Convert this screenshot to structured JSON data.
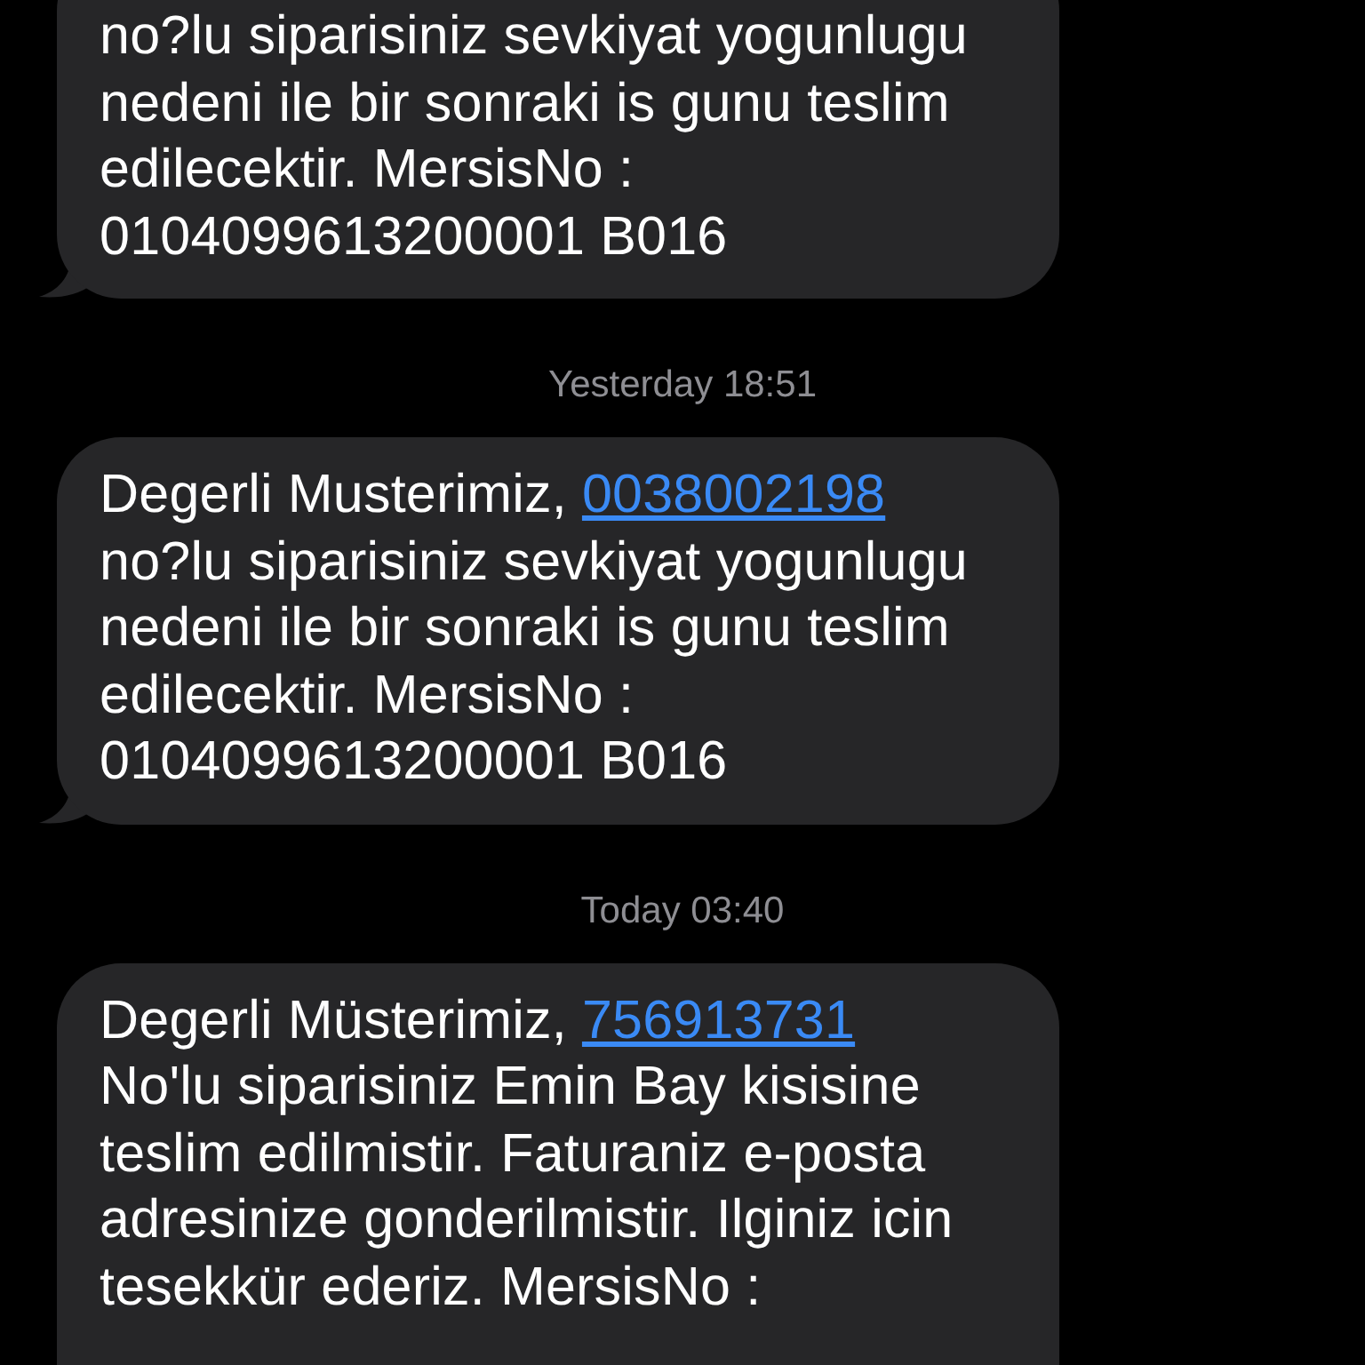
{
  "messages": [
    {
      "kind": "message",
      "text": "no?lu siparisiniz sevkiyat yogunlugu\nnedeni ile bir sonraki is gunu teslim\nedilecektir. MersisNo :\n0104099613200001 B016"
    },
    {
      "kind": "timestamp",
      "day": "Yesterday",
      "time": "18:51"
    },
    {
      "kind": "message",
      "greeting": "Degerli Musterimiz, ",
      "link": "0038002198",
      "text": "\nno?lu siparisiniz sevkiyat yogunlugu\nnedeni ile bir sonraki is gunu teslim\nedilecektir. MersisNo :\n0104099613200001 B016"
    },
    {
      "kind": "timestamp",
      "day": "Today",
      "time": "03:40"
    },
    {
      "kind": "message",
      "greeting": "Degerli Müsterimiz, ",
      "link": "756913731",
      "text": "\nNo'lu siparisiniz Emin Bay kisisine\nteslim edilmistir. Faturaniz e-posta\nadresinize gonderilmistir. Ilginiz icin\ntesekkür ederiz. MersisNo :"
    }
  ]
}
